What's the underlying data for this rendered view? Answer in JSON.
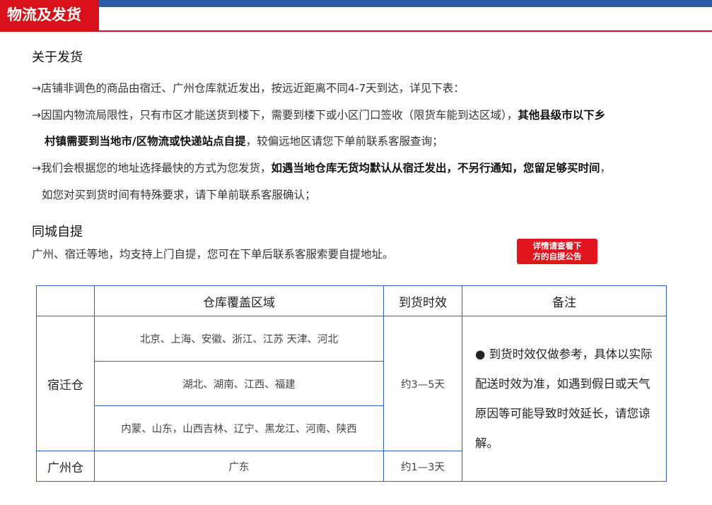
{
  "header": {
    "tag": "物流及发货"
  },
  "shipping": {
    "title": "关于发货",
    "line1": "→店铺非调色的商品由宿迁、广州仓库就近发出，按远近距离不同4-7天到达，详见下表：",
    "line2_plain": "→因国内物流局限性，只有市区才能送货到楼下，需要到楼下或小区门口签收（限货车能到达区域），",
    "line2_bold": "其他县级市以下乡",
    "line3_bold": "村镇需要到当地市/区物流或快递站点自提",
    "line3_plain": "，较偏远地区请您下单前联系客服查询；",
    "line4_plain": "→我们会根据您的地址选择最快的方式为您发货，",
    "line4_bold": "如遇当地仓库无货均默认从宿迁发出，不另行通知，您留足够买时间",
    "line4_end": "，",
    "line5": "如您对买到货时间有特殊要求，请下单前联系客服确认；"
  },
  "pickup": {
    "title": "同城自提",
    "text": "广州、宿迁等地，均支持上门自提，您可在下单后联系客服索要自提地址。",
    "notice_line1": "详情请查看下",
    "notice_line2": "方的自提公告"
  },
  "table": {
    "headers": [
      "仓库覆盖区域",
      "到货时效",
      "备注"
    ],
    "warehouse1": "宿迁仓",
    "regions1": [
      "北京、上海、安徽、浙江、江苏 天津、河北",
      "湖北、湖南、江西、福建",
      "内蒙、山东，山西吉林、辽宁、黑龙江、河南、陕西"
    ],
    "time1": "约3—5天",
    "warehouse2": "广州仓",
    "region2": "广东",
    "time2": "约1—3天",
    "note": "● 到货时效仅做参考，具体以实际配送时效为准，如遇到假日或天气原因等可能导致时效延长，请您谅解。"
  }
}
